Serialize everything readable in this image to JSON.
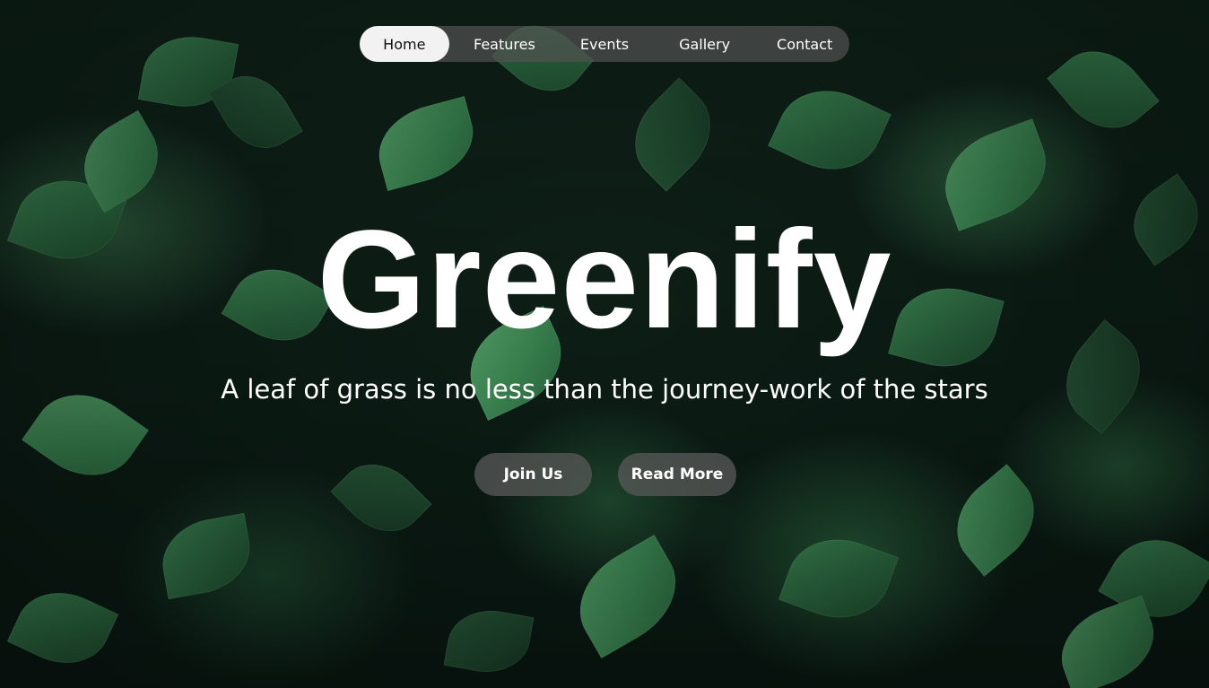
{
  "nav": {
    "items": [
      {
        "label": "Home",
        "active": true
      },
      {
        "label": "Features",
        "active": false
      },
      {
        "label": "Events",
        "active": false
      },
      {
        "label": "Gallery",
        "active": false
      },
      {
        "label": "Contact",
        "active": false
      }
    ]
  },
  "hero": {
    "title": "Greenify",
    "tagline": "A leaf of grass is no less than the journey-work of the stars",
    "buttons": {
      "join_label": "Join Us",
      "read_label": "Read More"
    }
  },
  "colors": {
    "text": "#ffffff",
    "nav_active_bg": "#f2f2f2",
    "nav_bg": "#505050",
    "button_bg": "#5a5a5a",
    "background_leaf": "#2c6a41"
  }
}
